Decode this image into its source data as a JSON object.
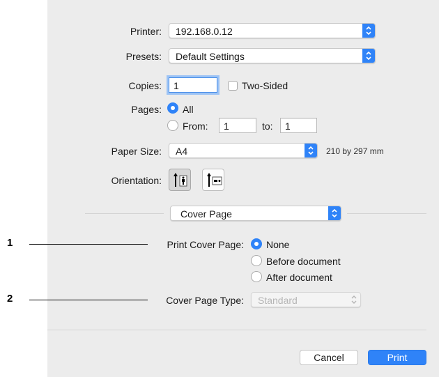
{
  "printer": {
    "label": "Printer:",
    "value": "192.168.0.12"
  },
  "presets": {
    "label": "Presets:",
    "value": "Default Settings"
  },
  "copies": {
    "label": "Copies:",
    "value": "1",
    "two_sided_label": "Two-Sided",
    "two_sided_checked": false
  },
  "pages": {
    "label": "Pages:",
    "all_label": "All",
    "all_selected": true,
    "from_label": "From:",
    "from_value": "1",
    "to_label": "to:",
    "to_value": "1"
  },
  "paper_size": {
    "label": "Paper Size:",
    "value": "A4",
    "dimensions": "210 by 297 mm"
  },
  "orientation": {
    "label": "Orientation:",
    "selected": "portrait"
  },
  "section": {
    "value": "Cover Page"
  },
  "print_cover_page": {
    "label": "Print Cover Page:",
    "options": [
      "None",
      "Before document",
      "After document"
    ],
    "selected": "None"
  },
  "cover_page_type": {
    "label": "Cover Page Type:",
    "value": "Standard",
    "enabled": false
  },
  "buttons": {
    "cancel": "Cancel",
    "print": "Print"
  },
  "callouts": {
    "first": "1",
    "second": "2"
  },
  "colors": {
    "accent": "#2f83f8",
    "panel": "#ececec"
  }
}
